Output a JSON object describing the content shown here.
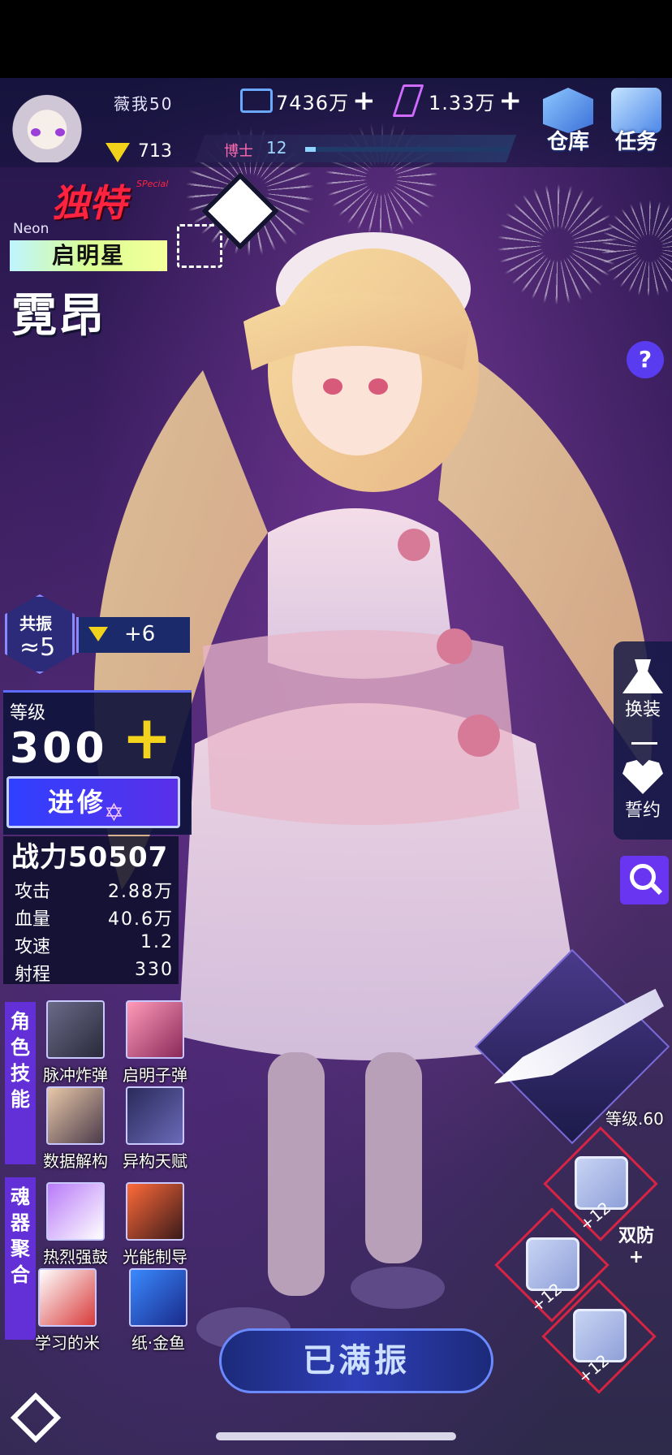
{
  "player": {
    "name": "薇我50",
    "rank": "713"
  },
  "resources": {
    "gold": "7436万",
    "gold_plus": "+",
    "crystal": "1.33万",
    "crystal_plus": "+"
  },
  "doctor": {
    "label": "博士",
    "level": "12",
    "progress": 0.05
  },
  "top_buttons": {
    "warehouse": "仓库",
    "tasks": "任务"
  },
  "character": {
    "rarity": "独特",
    "rarity_sub": "SPecial",
    "faction_en": "Neon",
    "faction": "启明星",
    "name": "霓昂"
  },
  "help": "?",
  "resonance": {
    "label": "共振",
    "level": "5",
    "bonus": "+6"
  },
  "level": {
    "title": "等级",
    "value": "300",
    "plus": "+",
    "advance": "进修",
    "advance_badge": "✡"
  },
  "stats": {
    "power": "战力50507",
    "rows": [
      {
        "label": "攻击",
        "value": "2.88万"
      },
      {
        "label": "血量",
        "value": "40.6万"
      },
      {
        "label": "攻速",
        "value": "1.2"
      },
      {
        "label": "射程",
        "value": "330"
      }
    ]
  },
  "skills": {
    "tag": "角色技能",
    "items": [
      {
        "label": "脉冲炸弹"
      },
      {
        "label": "启明子弹"
      },
      {
        "label": "数据解构"
      },
      {
        "label": "异构天赋"
      }
    ]
  },
  "soul": {
    "tag": "魂器聚合",
    "items": [
      {
        "label": "热烈强鼓"
      },
      {
        "label": "光能制导"
      },
      {
        "label": "学习的米"
      },
      {
        "label": "纸·金鱼"
      }
    ]
  },
  "side_menu": {
    "outfit": "换装",
    "vow": "誓约"
  },
  "weapon": {
    "level": "等级.60"
  },
  "gear": {
    "lv1": "+12",
    "lv2": "+12",
    "lv3": "+12",
    "def_tag": "双防+"
  },
  "bottom": {
    "max_button": "已满振"
  },
  "colors": {
    "accent": "#5a3cf0",
    "rarity": "#ff2340",
    "gold": "#f2d21a"
  }
}
